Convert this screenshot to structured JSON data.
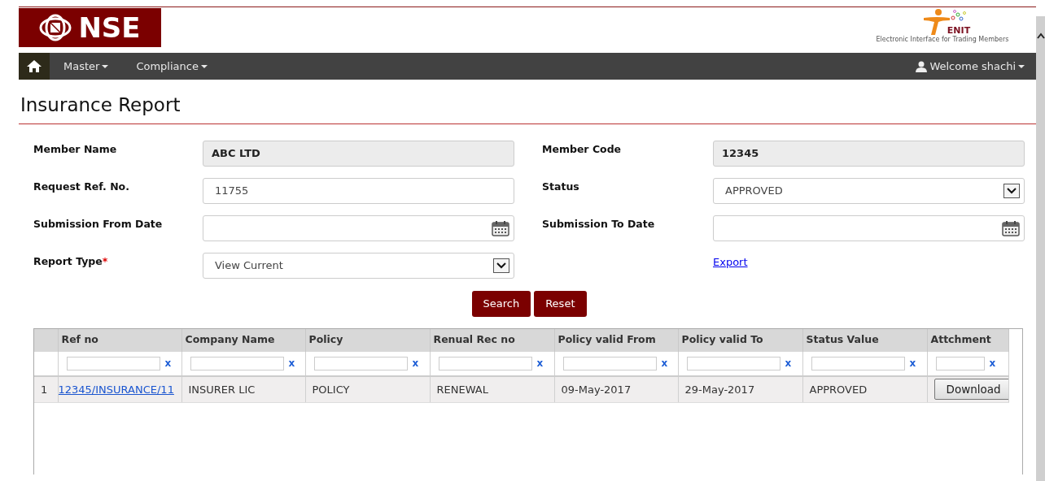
{
  "header": {
    "logo_text": "NSE",
    "partner_logo": {
      "name": "ENIT",
      "tagline": "Electronic Interface for Trading Members"
    }
  },
  "navbar": {
    "items": [
      {
        "label": "Master",
        "kind": "dropdown"
      },
      {
        "label": "Compliance",
        "kind": "dropdown"
      }
    ],
    "user": "Welcome shachi"
  },
  "page_title": "Insurance Report",
  "form": {
    "fields": [
      {
        "label": "Member Name",
        "kind": "readonly",
        "value": "ABC LTD"
      },
      {
        "label": "Member Code",
        "kind": "readonly",
        "value": "12345"
      },
      {
        "label": "Request Ref. No.",
        "kind": "text",
        "value": "11755"
      },
      {
        "label": "Status",
        "kind": "select",
        "value": "APPROVED"
      },
      {
        "label": "Submission From Date",
        "kind": "date"
      },
      {
        "label": "Submission To Date",
        "kind": "date"
      },
      {
        "label": "Report Type",
        "kind": "select",
        "value": "View Current",
        "required_mark": "*"
      },
      {
        "label": "Export",
        "kind": "link"
      }
    ],
    "buttons": [
      "Search",
      "Reset"
    ]
  },
  "table": {
    "columns": [
      {
        "label": "Ref no",
        "filter_clear": "x"
      },
      {
        "label": "Company Name",
        "filter_clear": "x"
      },
      {
        "label": "Policy",
        "filter_clear": "x"
      },
      {
        "label": "Renual Rec no",
        "filter_clear": "x"
      },
      {
        "label": "Policy valid From",
        "filter_clear": "x"
      },
      {
        "label": "Policy valid To",
        "filter_clear": "x"
      },
      {
        "label": "Status Value",
        "filter_clear": "x"
      },
      {
        "label": "Attchment",
        "filter_clear": "x"
      }
    ],
    "rows": [
      {
        "number": "1",
        "cells": [
          {
            "kind": "link",
            "text": "12345/INSURANCE/11"
          },
          {
            "kind": "text",
            "text": "INSURER LIC"
          },
          {
            "kind": "text",
            "text": "POLICY"
          },
          {
            "kind": "text",
            "text": "RENEWAL"
          },
          {
            "kind": "text",
            "text": "09-May-2017"
          },
          {
            "kind": "text",
            "text": "29-May-2017"
          },
          {
            "kind": "text",
            "text": "APPROVED"
          },
          {
            "kind": "button",
            "text": "Download"
          }
        ]
      }
    ]
  }
}
